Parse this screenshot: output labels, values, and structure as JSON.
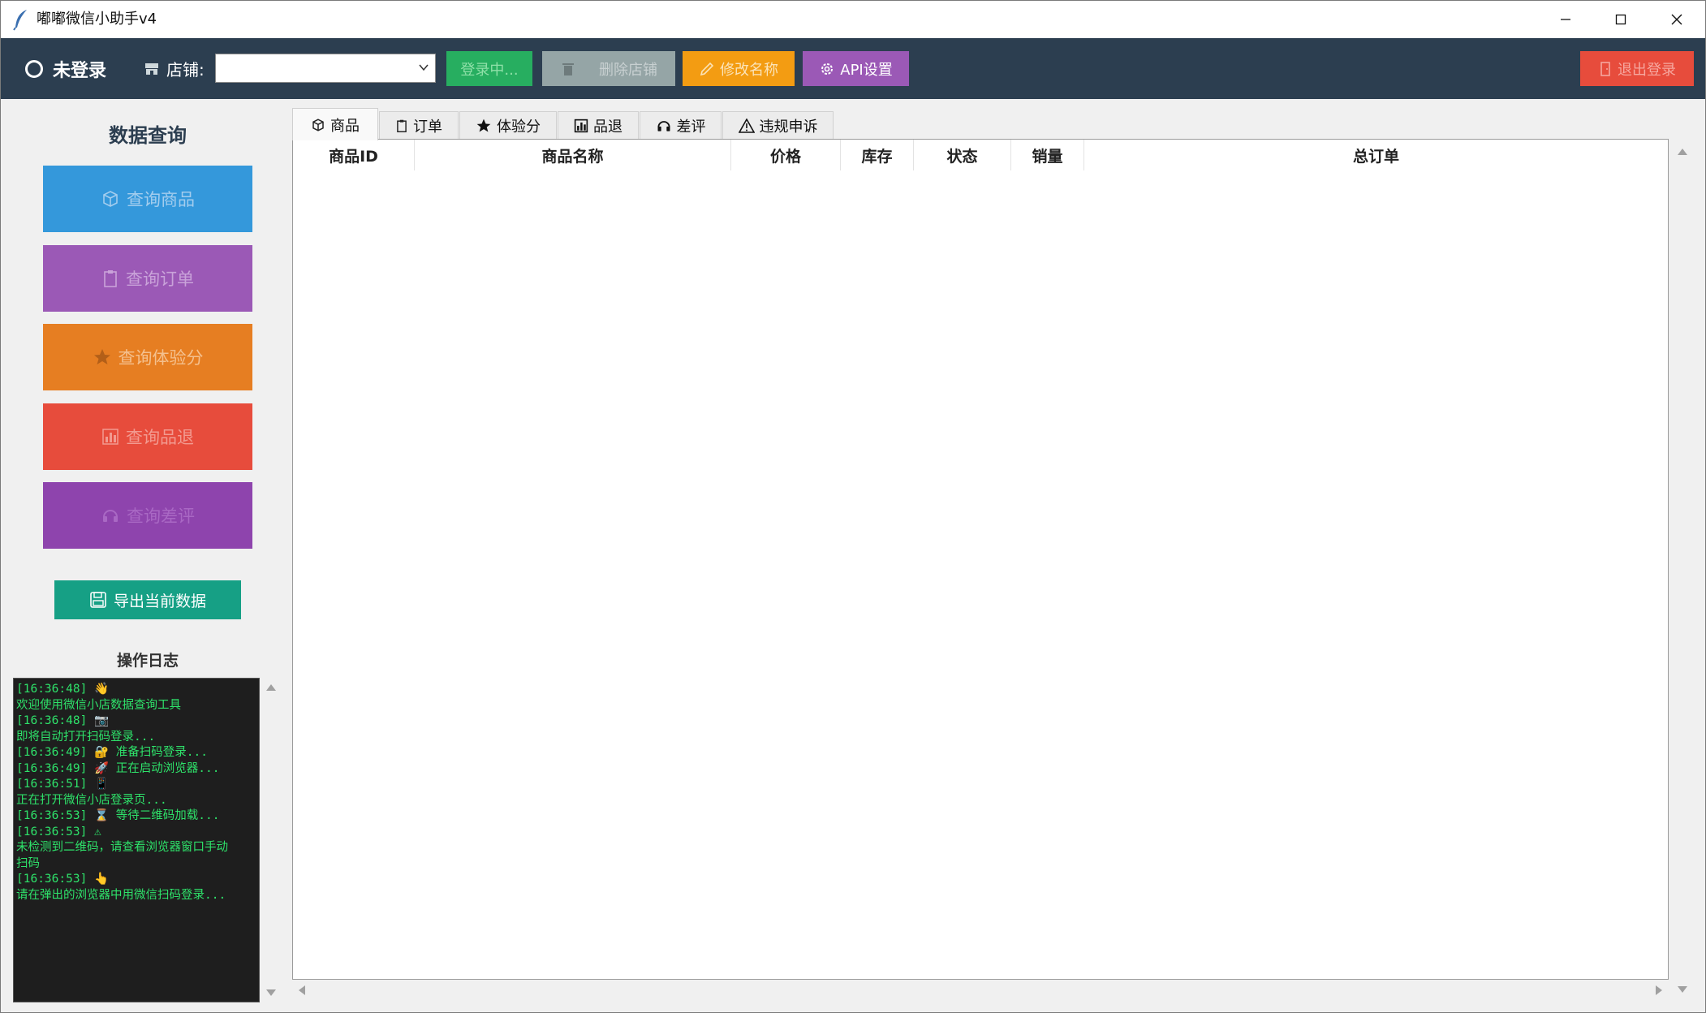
{
  "window": {
    "title": "嘟嘟微信小助手v4"
  },
  "toolbar": {
    "login_status": "未登录",
    "shop_label": "店铺:",
    "shop_value": "",
    "login_button": "登录中...",
    "delete_shop_button": "删除店铺",
    "rename_button": "修改名称",
    "api_button": "API设置",
    "logout_button": "退出登录"
  },
  "sidebar": {
    "title": "数据查询",
    "buttons": [
      {
        "label": "查询商品",
        "icon": "package-icon",
        "color": "#3498db"
      },
      {
        "label": "查询订单",
        "icon": "clipboard-icon",
        "color": "#9b59b6"
      },
      {
        "label": "查询体验分",
        "icon": "star-icon",
        "color": "#e67e22"
      },
      {
        "label": "查询品退",
        "icon": "bar-chart-icon",
        "color": "#e74c3c"
      },
      {
        "label": "查询差评",
        "icon": "headset-icon",
        "color": "#8e44ad"
      }
    ],
    "export_button": "导出当前数据"
  },
  "log": {
    "title": "操作日志",
    "lines": [
      "[16:36:48] 👋",
      "欢迎使用微信小店数据查询工具",
      "[16:36:48] 📷",
      "即将自动打开扫码登录...",
      "[16:36:49] 🔐 准备扫码登录...",
      "[16:36:49] 🚀 正在启动浏览器...",
      "[16:36:51] 📱",
      "正在打开微信小店登录页...",
      "[16:36:53] ⌛ 等待二维码加载...",
      "[16:36:53] ⚠",
      "未检测到二维码，请查看浏览器窗口手动",
      "扫码",
      "[16:36:53] 👆",
      "请在弹出的浏览器中用微信扫码登录..."
    ]
  },
  "tabs": [
    {
      "label": "商品",
      "icon": "package-icon",
      "active": true
    },
    {
      "label": "订单",
      "icon": "clipboard-icon",
      "active": false
    },
    {
      "label": "体验分",
      "icon": "star-icon",
      "active": false
    },
    {
      "label": "品退",
      "icon": "bar-chart-icon",
      "active": false
    },
    {
      "label": "差评",
      "icon": "headset-icon",
      "active": false
    },
    {
      "label": "违规申诉",
      "icon": "warning-icon",
      "active": false
    }
  ],
  "table": {
    "columns": [
      "商品ID",
      "商品名称",
      "价格",
      "库存",
      "状态",
      "销量",
      "总订单"
    ],
    "rows": []
  },
  "colors": {
    "toolbar_bg": "#2c3e50",
    "login_button": "#27ae60",
    "delete_button": "#95a5a6",
    "rename_button": "#f39c12",
    "api_button": "#9b59b6",
    "logout_button": "#e74c3c",
    "export_button": "#16a085",
    "log_text": "#2ee26a"
  }
}
